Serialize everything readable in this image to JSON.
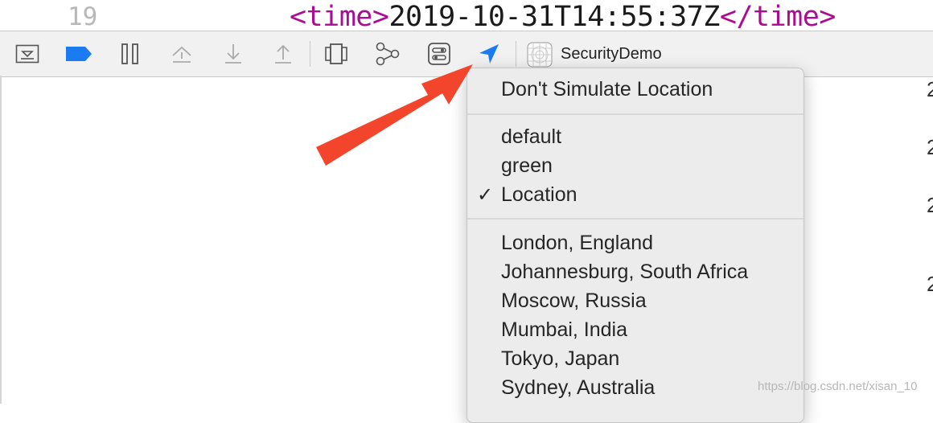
{
  "editor": {
    "line_number": "19",
    "open_tag": "<time>",
    "value": "2019-10-31T14:55:37Z",
    "close_tag": "</time>"
  },
  "toolbar": {
    "target_name": "SecurityDemo",
    "icons": [
      "hide-debug-area-icon",
      "breakpoints-icon",
      "pause-icon",
      "step-over-icon",
      "step-into-icon",
      "step-out-icon",
      "view-hierarchy-icon",
      "memory-graph-icon",
      "environment-overrides-icon",
      "simulate-location-icon",
      "app-icon"
    ],
    "accent": "#1b7cf2"
  },
  "menu": {
    "dont_simulate": "Don't Simulate Location",
    "group1": [
      {
        "label": "default",
        "checked": false
      },
      {
        "label": "green",
        "checked": false
      },
      {
        "label": "Location",
        "checked": true
      }
    ],
    "check_mark": "✓",
    "group2": [
      "London, England",
      "Johannesburg, South Africa",
      "Moscow, Russia",
      "Mumbai, India",
      "Tokyo, Japan",
      "Sydney, Australia"
    ]
  },
  "right_numbers": [
    "2",
    "2",
    "2",
    "2"
  ],
  "watermark": "https://blog.csdn.net/xisan_10",
  "annotation": {
    "arrow_color": "#f2452b"
  }
}
